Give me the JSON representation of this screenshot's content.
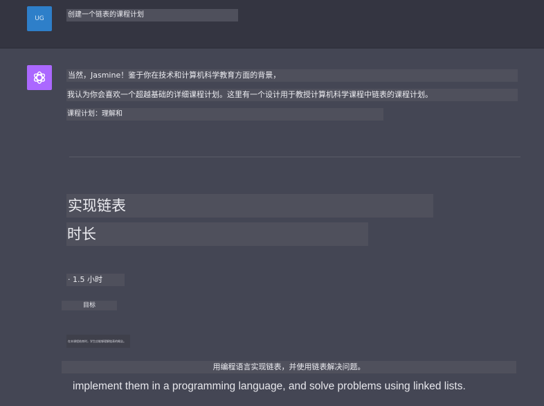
{
  "user": {
    "avatar_initials": "UG",
    "message": "创建一个链表的课程计划"
  },
  "assistant": {
    "avatar_icon": "openai-logo-icon",
    "avatar_color": "#ab68ff",
    "para1": "当然，Jasmine！鉴于你在技术和计算机科学教育方面的背景，",
    "para2": "我认为你会喜欢一个超越基础的详细课程计划。这里有一个设计用于教授计算机科学课程中链表的课程计划。",
    "para3": "课程计划：理解和",
    "heading1": "实现链表",
    "heading2": "时长",
    "bullet": "· 1.5 小时",
    "goal_label": "目标",
    "tiny_text": "在本课程结束时，学生应能够理解链表的概念。",
    "wide_text": "用编程语言实现链表，并使用链表解决问题。",
    "english_text": "implement them in a programming language, and solve problems using linked lists."
  },
  "colors": {
    "background": "#444654",
    "user_row": "#343541",
    "user_avatar": "#2e7fc9",
    "highlight": "#4f505c"
  }
}
